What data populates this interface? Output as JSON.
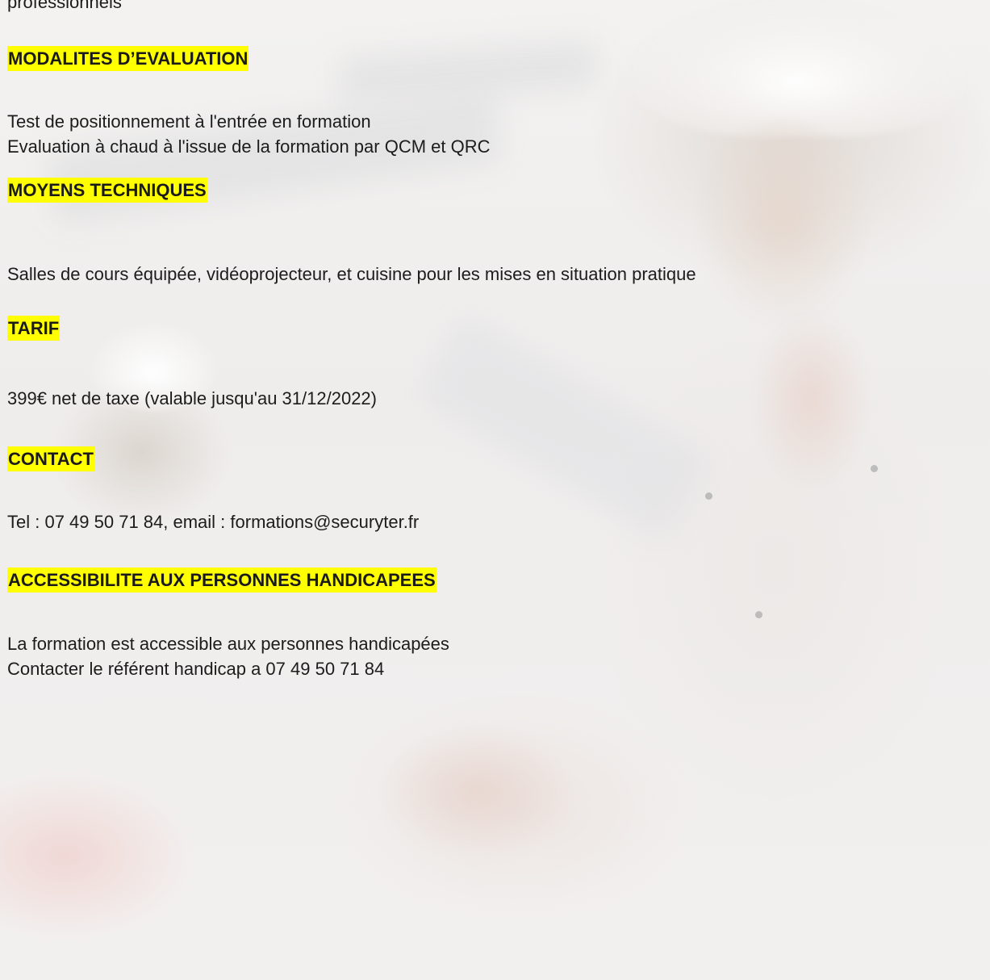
{
  "top_fragment": "professionnels",
  "sections": {
    "evaluation": {
      "heading": "MODALITES D’EVALUATION",
      "lines": [
        "Test de positionnement à l'entrée en formation",
        "Evaluation à chaud à l'issue de la formation par QCM et QRC"
      ]
    },
    "moyens": {
      "heading": "MOYENS TECHNIQUES",
      "lines": [
        "Salles de cours équipée, vidéoprojecteur, et cuisine pour les mises en situation pratique"
      ]
    },
    "tarif": {
      "heading": "TARIF",
      "lines": [
        "399€ net de taxe (valable jusqu'au 31/12/2022)"
      ]
    },
    "contact": {
      "heading": "CONTACT",
      "lines": [
        "Tel : 07 49 50 71 84, email : formations@securyter.fr"
      ]
    },
    "accessibilite": {
      "heading": "ACCESSIBILITE AUX PERSONNES HANDICAPEES",
      "lines": [
        "La formation est accessible aux personnes handicapées",
        "Contacter le référent handicap a 07 49 50 71 84"
      ]
    }
  },
  "colors": {
    "heading_highlight": "#ffff00",
    "text": "#1c1c1c",
    "background": "#f4f2f1"
  }
}
